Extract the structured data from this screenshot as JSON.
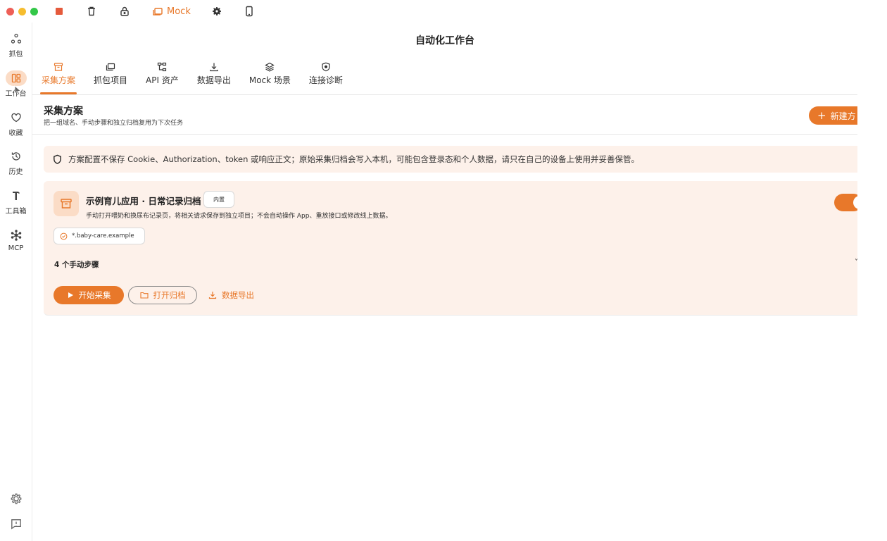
{
  "titlebar": {
    "mock_label": "Mock",
    "colors": {
      "close": "#ee5f57",
      "minimize": "#f6bd2f",
      "zoom": "#33c748",
      "record": "#e55a3c"
    }
  },
  "sidebar": {
    "items": [
      {
        "label": "抓包",
        "icon": "share-nodes-icon"
      },
      {
        "label": "工作台",
        "icon": "dashboard-icon",
        "active": true
      },
      {
        "label": "收藏",
        "icon": "heart-icon"
      },
      {
        "label": "历史",
        "icon": "history-icon"
      },
      {
        "label": "工具箱",
        "icon": "hammer-icon"
      },
      {
        "label": "MCP",
        "icon": "network-hub-icon"
      }
    ],
    "bottom": [
      "settings-icon",
      "feedback-icon"
    ]
  },
  "page": {
    "title": "自动化工作台"
  },
  "tabs": [
    {
      "label": "采集方案",
      "icon": "archive-icon",
      "active": true
    },
    {
      "label": "抓包项目",
      "icon": "folders-icon"
    },
    {
      "label": "API 资产",
      "icon": "tree-icon"
    },
    {
      "label": "数据导出",
      "icon": "download-icon"
    },
    {
      "label": "Mock 场景",
      "icon": "layers-icon"
    },
    {
      "label": "连接诊断",
      "icon": "shield-check-icon"
    }
  ],
  "section": {
    "title": "采集方案",
    "subtitle": "把一组域名、手动步骤和独立归档复用为下次任务",
    "new_button": "新建方"
  },
  "notice": {
    "text": "方案配置不保存 Cookie、Authorization、token 或响应正文；原始采集归档会写入本机，可能包含登录态和个人数据，请只在自己的设备上使用并妥善保管。"
  },
  "plan_card": {
    "title": "示例育儿应用 · 日常记录归档",
    "badge": "内置",
    "description": "手动打开喂奶和换尿布记录页，将相关请求保存到独立项目；不会自动操作 App、重放接口或修改线上数据。",
    "enabled": true,
    "domain": "*.baby-care.example",
    "steps": "4 个手动步骤",
    "start_button": "开始采集",
    "open_button": "打开归档",
    "export_button": "数据导出"
  },
  "accent": "#e8782a"
}
